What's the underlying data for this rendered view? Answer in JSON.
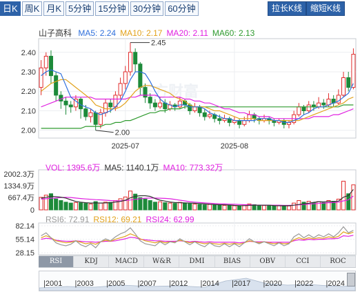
{
  "periods": [
    "日K",
    "周K",
    "月K",
    "5分钟",
    "15分钟",
    "30分钟",
    "60分钟"
  ],
  "active_period": "日K",
  "actions": {
    "zoom_in": "拉长K线",
    "zoom_out": "缩短K线"
  },
  "stock_name": "山子高科",
  "ma_legend": [
    {
      "label": "MA5: 2.24",
      "color": "#2f6fdb"
    },
    {
      "label": "MA10: 2.17",
      "color": "#e2a21c"
    },
    {
      "label": "MA20: 2.11",
      "color": "#e020e0"
    },
    {
      "label": "MA60: 2.13",
      "color": "#2e9a2e"
    }
  ],
  "price_axis": [
    "2.40",
    "2.30",
    "2.20",
    "2.10",
    "2.00"
  ],
  "date_labels": [
    "2025-07",
    "2025-08"
  ],
  "annotations": {
    "high": "2.45",
    "low": "2.00"
  },
  "watermark": "东方财富",
  "volume_legend": [
    {
      "label": "VOL: 1395.6万",
      "color": "#e020e0"
    },
    {
      "label": "MA5: 1140.1万",
      "color": "#333333"
    },
    {
      "label": "MA10: 773.32万",
      "color": "#e020e0"
    }
  ],
  "volume_axis": [
    "2002.3万",
    "1334.9万",
    "667.4万",
    "0"
  ],
  "rsi_legend": [
    {
      "label": "RSI6: 72.91",
      "color": "#999999"
    },
    {
      "label": "RSI12: 69.21",
      "color": "#e2a21c"
    },
    {
      "label": "RSI24: 62.99",
      "color": "#e020e0"
    }
  ],
  "rsi_axis": [
    "82.14",
    "55.14",
    "28.15"
  ],
  "indicator_tabs": [
    "RSI",
    "KDJ",
    "MACD",
    "W&R",
    "DMI",
    "BIAS",
    "OBV",
    "CCI",
    "ROC"
  ],
  "active_indicator": "RSI",
  "navigator_years": [
    "2001",
    "2003",
    "2005",
    "2007",
    "2012",
    "2014",
    "2017",
    "2020",
    "2022",
    "2024"
  ],
  "chart_data": {
    "type": "candlestick",
    "price_range": [
      1.96,
      2.47
    ],
    "candles": [
      [
        2.22,
        2.32,
        2.36,
        2.18
      ],
      [
        2.32,
        2.38,
        2.4,
        2.28
      ],
      [
        2.38,
        2.28,
        2.41,
        2.24
      ],
      [
        2.28,
        2.18,
        2.3,
        2.15
      ],
      [
        2.18,
        2.15,
        2.2,
        2.11
      ],
      [
        2.15,
        2.13,
        2.17,
        2.08
      ],
      [
        2.13,
        2.12,
        2.15,
        2.09
      ],
      [
        2.12,
        2.16,
        2.18,
        2.1
      ],
      [
        2.16,
        2.11,
        2.17,
        2.06
      ],
      [
        2.11,
        2.07,
        2.13,
        2.05
      ],
      [
        2.07,
        2.09,
        2.11,
        2.04
      ],
      [
        2.09,
        2.03,
        2.1,
        2.0
      ],
      [
        2.03,
        2.09,
        2.11,
        2.01
      ],
      [
        2.09,
        2.14,
        2.16,
        2.07
      ],
      [
        2.14,
        2.12,
        2.16,
        2.09
      ],
      [
        2.12,
        2.18,
        2.2,
        2.1
      ],
      [
        2.18,
        2.24,
        2.27,
        2.16
      ],
      [
        2.24,
        2.3,
        2.33,
        2.21
      ],
      [
        2.3,
        2.4,
        2.45,
        2.28
      ],
      [
        2.4,
        2.34,
        2.42,
        2.3
      ],
      [
        2.34,
        2.22,
        2.35,
        2.18
      ],
      [
        2.22,
        2.17,
        2.24,
        2.14
      ],
      [
        2.17,
        2.14,
        2.19,
        2.11
      ],
      [
        2.14,
        2.12,
        2.16,
        2.1
      ],
      [
        2.12,
        2.14,
        2.17,
        2.11
      ],
      [
        2.14,
        2.11,
        2.16,
        2.09
      ],
      [
        2.11,
        2.13,
        2.15,
        2.1
      ],
      [
        2.13,
        2.12,
        2.14,
        2.1
      ],
      [
        2.12,
        2.15,
        2.17,
        2.11
      ],
      [
        2.15,
        2.13,
        2.16,
        2.11
      ],
      [
        2.13,
        2.1,
        2.14,
        2.08
      ],
      [
        2.1,
        2.12,
        2.14,
        2.09
      ],
      [
        2.12,
        2.09,
        2.13,
        2.07
      ],
      [
        2.09,
        2.07,
        2.11,
        2.05
      ],
      [
        2.07,
        2.08,
        2.1,
        2.06
      ],
      [
        2.08,
        2.06,
        2.09,
        2.04
      ],
      [
        2.06,
        2.05,
        2.08,
        2.03
      ],
      [
        2.05,
        2.06,
        2.08,
        2.04
      ],
      [
        2.06,
        2.04,
        2.07,
        2.02
      ],
      [
        2.04,
        2.05,
        2.07,
        2.03
      ],
      [
        2.05,
        2.03,
        2.06,
        2.01
      ],
      [
        2.03,
        2.05,
        2.07,
        2.02
      ],
      [
        2.05,
        2.08,
        2.1,
        2.04
      ],
      [
        2.08,
        2.06,
        2.09,
        2.04
      ],
      [
        2.06,
        2.05,
        2.07,
        2.03
      ],
      [
        2.05,
        2.06,
        2.08,
        2.04
      ],
      [
        2.06,
        2.05,
        2.07,
        2.03
      ],
      [
        2.05,
        2.04,
        2.06,
        2.02
      ],
      [
        2.04,
        2.05,
        2.06,
        2.03
      ],
      [
        2.05,
        2.03,
        2.06,
        2.01
      ],
      [
        2.03,
        2.04,
        2.05,
        2.01
      ],
      [
        2.04,
        2.08,
        2.1,
        2.03
      ],
      [
        2.08,
        2.12,
        2.14,
        2.07
      ],
      [
        2.12,
        2.1,
        2.13,
        2.08
      ],
      [
        2.1,
        2.13,
        2.15,
        2.09
      ],
      [
        2.13,
        2.12,
        2.15,
        2.1
      ],
      [
        2.12,
        2.14,
        2.17,
        2.11
      ],
      [
        2.14,
        2.13,
        2.16,
        2.11
      ],
      [
        2.13,
        2.16,
        2.19,
        2.12
      ],
      [
        2.16,
        2.14,
        2.18,
        2.12
      ],
      [
        2.14,
        2.18,
        2.21,
        2.13
      ],
      [
        2.18,
        2.27,
        2.3,
        2.17
      ],
      [
        2.27,
        2.22,
        2.3,
        2.2
      ],
      [
        2.22,
        2.39,
        2.42,
        2.21
      ]
    ],
    "ma5": [
      2.28,
      2.3,
      2.31,
      2.3,
      2.29,
      2.23,
      2.17,
      2.15,
      2.13,
      2.12,
      2.11,
      2.09,
      2.08,
      2.09,
      2.1,
      2.12,
      2.15,
      2.2,
      2.26,
      2.3,
      2.3,
      2.29,
      2.25,
      2.2,
      2.16,
      2.14,
      2.13,
      2.12,
      2.13,
      2.13,
      2.12,
      2.12,
      2.12,
      2.11,
      2.09,
      2.08,
      2.07,
      2.06,
      2.06,
      2.05,
      2.05,
      2.05,
      2.05,
      2.05,
      2.06,
      2.06,
      2.06,
      2.05,
      2.05,
      2.04,
      2.04,
      2.05,
      2.06,
      2.08,
      2.09,
      2.11,
      2.12,
      2.12,
      2.13,
      2.14,
      2.15,
      2.17,
      2.19,
      2.24
    ],
    "ma10": [
      2.2,
      2.22,
      2.24,
      2.25,
      2.26,
      2.26,
      2.24,
      2.22,
      2.2,
      2.18,
      2.16,
      2.13,
      2.12,
      2.11,
      2.11,
      2.11,
      2.12,
      2.14,
      2.17,
      2.2,
      2.22,
      2.23,
      2.23,
      2.22,
      2.21,
      2.2,
      2.19,
      2.17,
      2.16,
      2.15,
      2.13,
      2.12,
      2.12,
      2.12,
      2.11,
      2.1,
      2.1,
      2.09,
      2.08,
      2.07,
      2.06,
      2.06,
      2.06,
      2.06,
      2.05,
      2.05,
      2.05,
      2.05,
      2.05,
      2.05,
      2.05,
      2.05,
      2.05,
      2.06,
      2.07,
      2.08,
      2.09,
      2.1,
      2.11,
      2.12,
      2.13,
      2.14,
      2.16,
      2.17
    ],
    "ma20": [
      2.12,
      2.13,
      2.14,
      2.15,
      2.16,
      2.17,
      2.17,
      2.17,
      2.17,
      2.17,
      2.17,
      2.16,
      2.16,
      2.16,
      2.16,
      2.16,
      2.16,
      2.16,
      2.17,
      2.17,
      2.18,
      2.18,
      2.18,
      2.18,
      2.17,
      2.17,
      2.17,
      2.17,
      2.17,
      2.16,
      2.16,
      2.15,
      2.15,
      2.14,
      2.14,
      2.13,
      2.12,
      2.11,
      2.11,
      2.1,
      2.09,
      2.09,
      2.08,
      2.08,
      2.07,
      2.07,
      2.07,
      2.06,
      2.06,
      2.06,
      2.06,
      2.06,
      2.06,
      2.06,
      2.06,
      2.07,
      2.07,
      2.07,
      2.07,
      2.08,
      2.08,
      2.09,
      2.1,
      2.11
    ],
    "ma60": [
      2.01,
      2.01,
      2.01,
      2.01,
      2.01,
      2.01,
      2.01,
      2.01,
      2.01,
      2.02,
      2.02,
      2.02,
      2.02,
      2.03,
      2.03,
      2.04,
      2.04,
      2.05,
      2.05,
      2.06,
      2.07,
      2.08,
      2.09,
      2.09,
      2.1,
      2.1,
      2.11,
      2.11,
      2.11,
      2.12,
      2.12,
      2.12,
      2.12,
      2.12,
      2.12,
      2.12,
      2.12,
      2.12,
      2.12,
      2.12,
      2.12,
      2.12,
      2.12,
      2.12,
      2.12,
      2.12,
      2.12,
      2.12,
      2.12,
      2.12,
      2.12,
      2.12,
      2.12,
      2.12,
      2.12,
      2.12,
      2.12,
      2.12,
      2.12,
      2.12,
      2.12,
      2.13,
      2.13,
      2.13
    ],
    "volume_range": [
      0,
      2002.3
    ],
    "volume": [
      700,
      820,
      900,
      610,
      520,
      430,
      380,
      410,
      390,
      360,
      330,
      460,
      380,
      430,
      420,
      520,
      620,
      720,
      1050,
      880,
      680,
      600,
      520,
      430,
      450,
      400,
      380,
      360,
      420,
      380,
      340,
      320,
      300,
      280,
      300,
      290,
      260,
      250,
      240,
      230,
      220,
      240,
      330,
      290,
      260,
      240,
      230,
      220,
      240,
      230,
      220,
      380,
      520,
      430,
      480,
      400,
      460,
      410,
      520,
      480,
      600,
      1600,
      900,
      1395.6
    ],
    "vol_ma5": [
      650,
      700,
      760,
      740,
      710,
      660,
      560,
      470,
      430,
      400,
      380,
      390,
      380,
      390,
      400,
      440,
      470,
      540,
      670,
      760,
      790,
      790,
      750,
      630,
      540,
      490,
      440,
      410,
      400,
      390,
      380,
      370,
      350,
      330,
      310,
      300,
      290,
      280,
      270,
      250,
      240,
      240,
      250,
      260,
      260,
      260,
      260,
      240,
      230,
      230,
      230,
      260,
      300,
      330,
      370,
      420,
      460,
      450,
      470,
      460,
      490,
      710,
      800,
      1140.1
    ],
    "vol_ma10": [
      600,
      620,
      650,
      670,
      690,
      700,
      690,
      660,
      630,
      610,
      590,
      570,
      560,
      540,
      520,
      510,
      510,
      520,
      550,
      590,
      620,
      650,
      660,
      660,
      650,
      640,
      620,
      580,
      540,
      500,
      460,
      430,
      410,
      390,
      370,
      350,
      340,
      330,
      320,
      310,
      300,
      290,
      280,
      270,
      260,
      260,
      260,
      260,
      260,
      250,
      250,
      260,
      280,
      300,
      320,
      340,
      360,
      380,
      400,
      410,
      430,
      500,
      560,
      773.3
    ],
    "rsi_range": [
      28.15,
      82.14
    ],
    "rsi6": [
      62,
      68,
      58,
      48,
      44,
      42,
      45,
      52,
      44,
      40,
      46,
      38,
      50,
      56,
      52,
      60,
      66,
      70,
      78,
      66,
      52,
      46,
      44,
      42,
      50,
      44,
      50,
      48,
      56,
      50,
      44,
      50,
      44,
      40,
      48,
      42,
      40,
      46,
      40,
      46,
      40,
      48,
      56,
      50,
      46,
      50,
      46,
      42,
      48,
      42,
      46,
      60,
      66,
      58,
      64,
      58,
      64,
      60,
      66,
      60,
      68,
      80,
      68,
      72.91
    ],
    "rsi12": [
      58,
      62,
      58,
      52,
      50,
      48,
      49,
      52,
      49,
      46,
      48,
      45,
      50,
      53,
      51,
      55,
      58,
      61,
      66,
      62,
      56,
      52,
      50,
      48,
      51,
      48,
      50,
      49,
      53,
      51,
      48,
      50,
      48,
      46,
      48,
      46,
      45,
      47,
      45,
      47,
      45,
      48,
      52,
      50,
      48,
      50,
      48,
      46,
      48,
      46,
      47,
      54,
      58,
      55,
      58,
      56,
      58,
      57,
      60,
      58,
      61,
      70,
      66,
      69.21
    ],
    "rsi24": [
      55,
      57,
      56,
      53,
      52,
      51,
      51,
      52,
      51,
      50,
      50,
      49,
      50,
      51,
      51,
      52,
      54,
      56,
      59,
      58,
      55,
      54,
      53,
      52,
      52,
      51,
      51,
      51,
      52,
      51,
      50,
      51,
      50,
      49,
      50,
      49,
      49,
      49,
      49,
      49,
      48,
      49,
      51,
      50,
      50,
      50,
      49,
      49,
      49,
      49,
      49,
      52,
      54,
      53,
      55,
      54,
      55,
      55,
      56,
      56,
      57,
      62,
      61,
      62.99
    ]
  }
}
